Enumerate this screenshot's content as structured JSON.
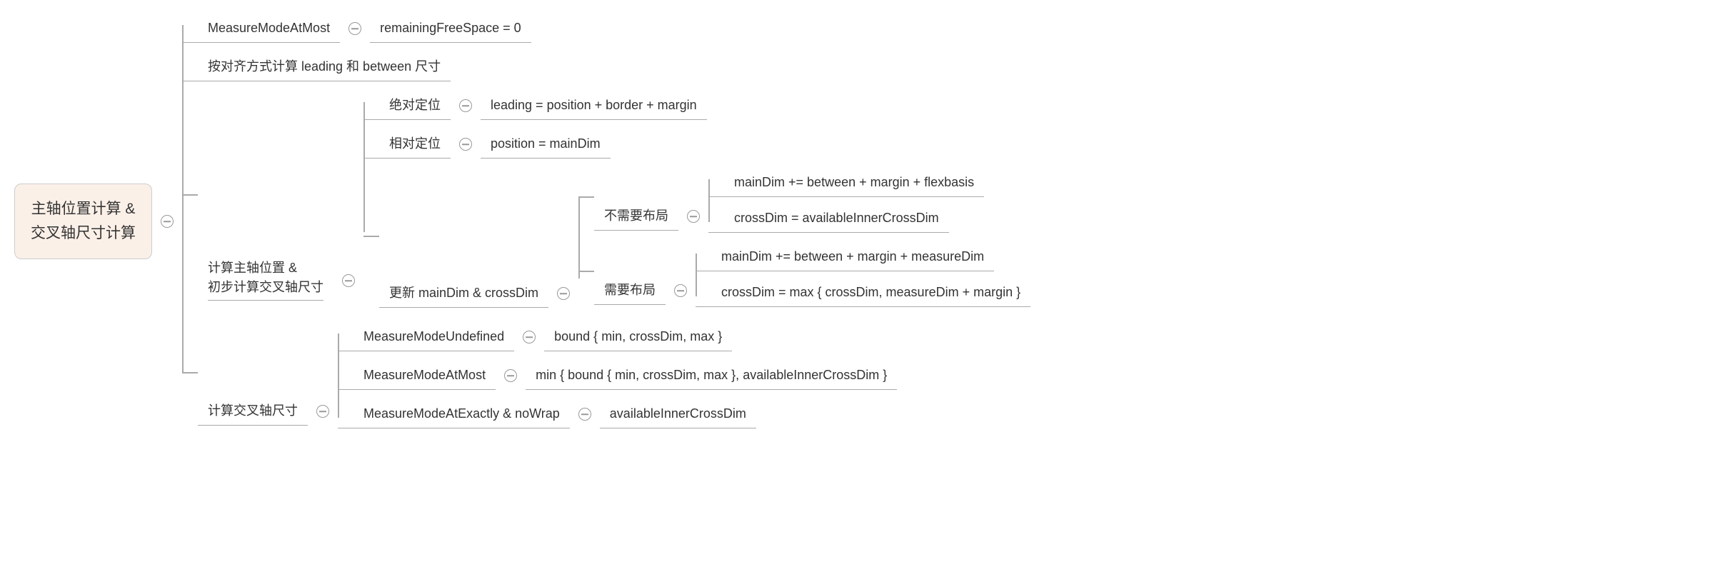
{
  "root": {
    "line1": "主轴位置计算 &",
    "line2": "交叉轴尺寸计算"
  },
  "c1": {
    "label": "MeasureModeAtMost",
    "leaf": "remainingFreeSpace = 0"
  },
  "c2": {
    "label": "按对齐方式计算 leading 和 between 尺寸"
  },
  "c3": {
    "label_line1": "计算主轴位置 &",
    "label_line2": "初步计算交叉轴尺寸",
    "sub1": {
      "label": "绝对定位",
      "leaf": "leading = position + border + margin"
    },
    "sub2": {
      "label": "相对定位",
      "leaf": "position = mainDim"
    },
    "sub3": {
      "label": "更新 mainDim & crossDim",
      "a": {
        "label": "不需要布局",
        "l1": "mainDim += between + margin + flexbasis",
        "l2": "crossDim = availableInnerCrossDim"
      },
      "b": {
        "label": "需要布局",
        "l1": "mainDim += between + margin + measureDim",
        "l2": "crossDim = max { crossDim, measureDim + margin }"
      }
    }
  },
  "c4": {
    "label": "计算交叉轴尺寸",
    "s1": {
      "label": "MeasureModeUndefined",
      "leaf": "bound { min, crossDim, max }"
    },
    "s2": {
      "label": "MeasureModeAtMost",
      "leaf": "min { bound { min, crossDim, max }, availableInnerCrossDim }"
    },
    "s3": {
      "label": "MeasureModeAtExactly & noWrap",
      "leaf": "availableInnerCrossDim"
    }
  }
}
